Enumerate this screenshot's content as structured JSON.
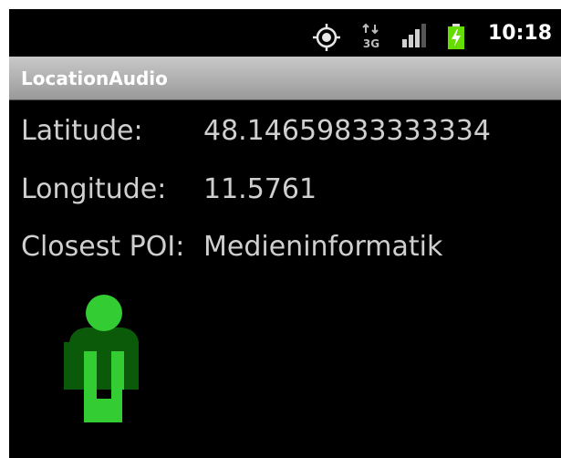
{
  "status_bar": {
    "time": "10:18",
    "network_label": "3G",
    "icons": [
      "gps-icon",
      "network-3g-icon",
      "signal-icon",
      "battery-charging-icon"
    ]
  },
  "app": {
    "title": "LocationAudio"
  },
  "fields": [
    {
      "label": "Latitude:",
      "value": "48.14659833333334"
    },
    {
      "label": "Longitude:",
      "value": "11.5761"
    },
    {
      "label": "Closest POI:",
      "value": "Medieninformatik"
    }
  ],
  "colors": {
    "background": "#000000",
    "text": "#cfcfcf",
    "title_bar": "#b0b0b0",
    "figure_light_green": "#33cc33",
    "figure_dark_green": "#0a5a0a",
    "battery_green": "#66dd00"
  },
  "figure": {
    "icon": "person-icon"
  }
}
